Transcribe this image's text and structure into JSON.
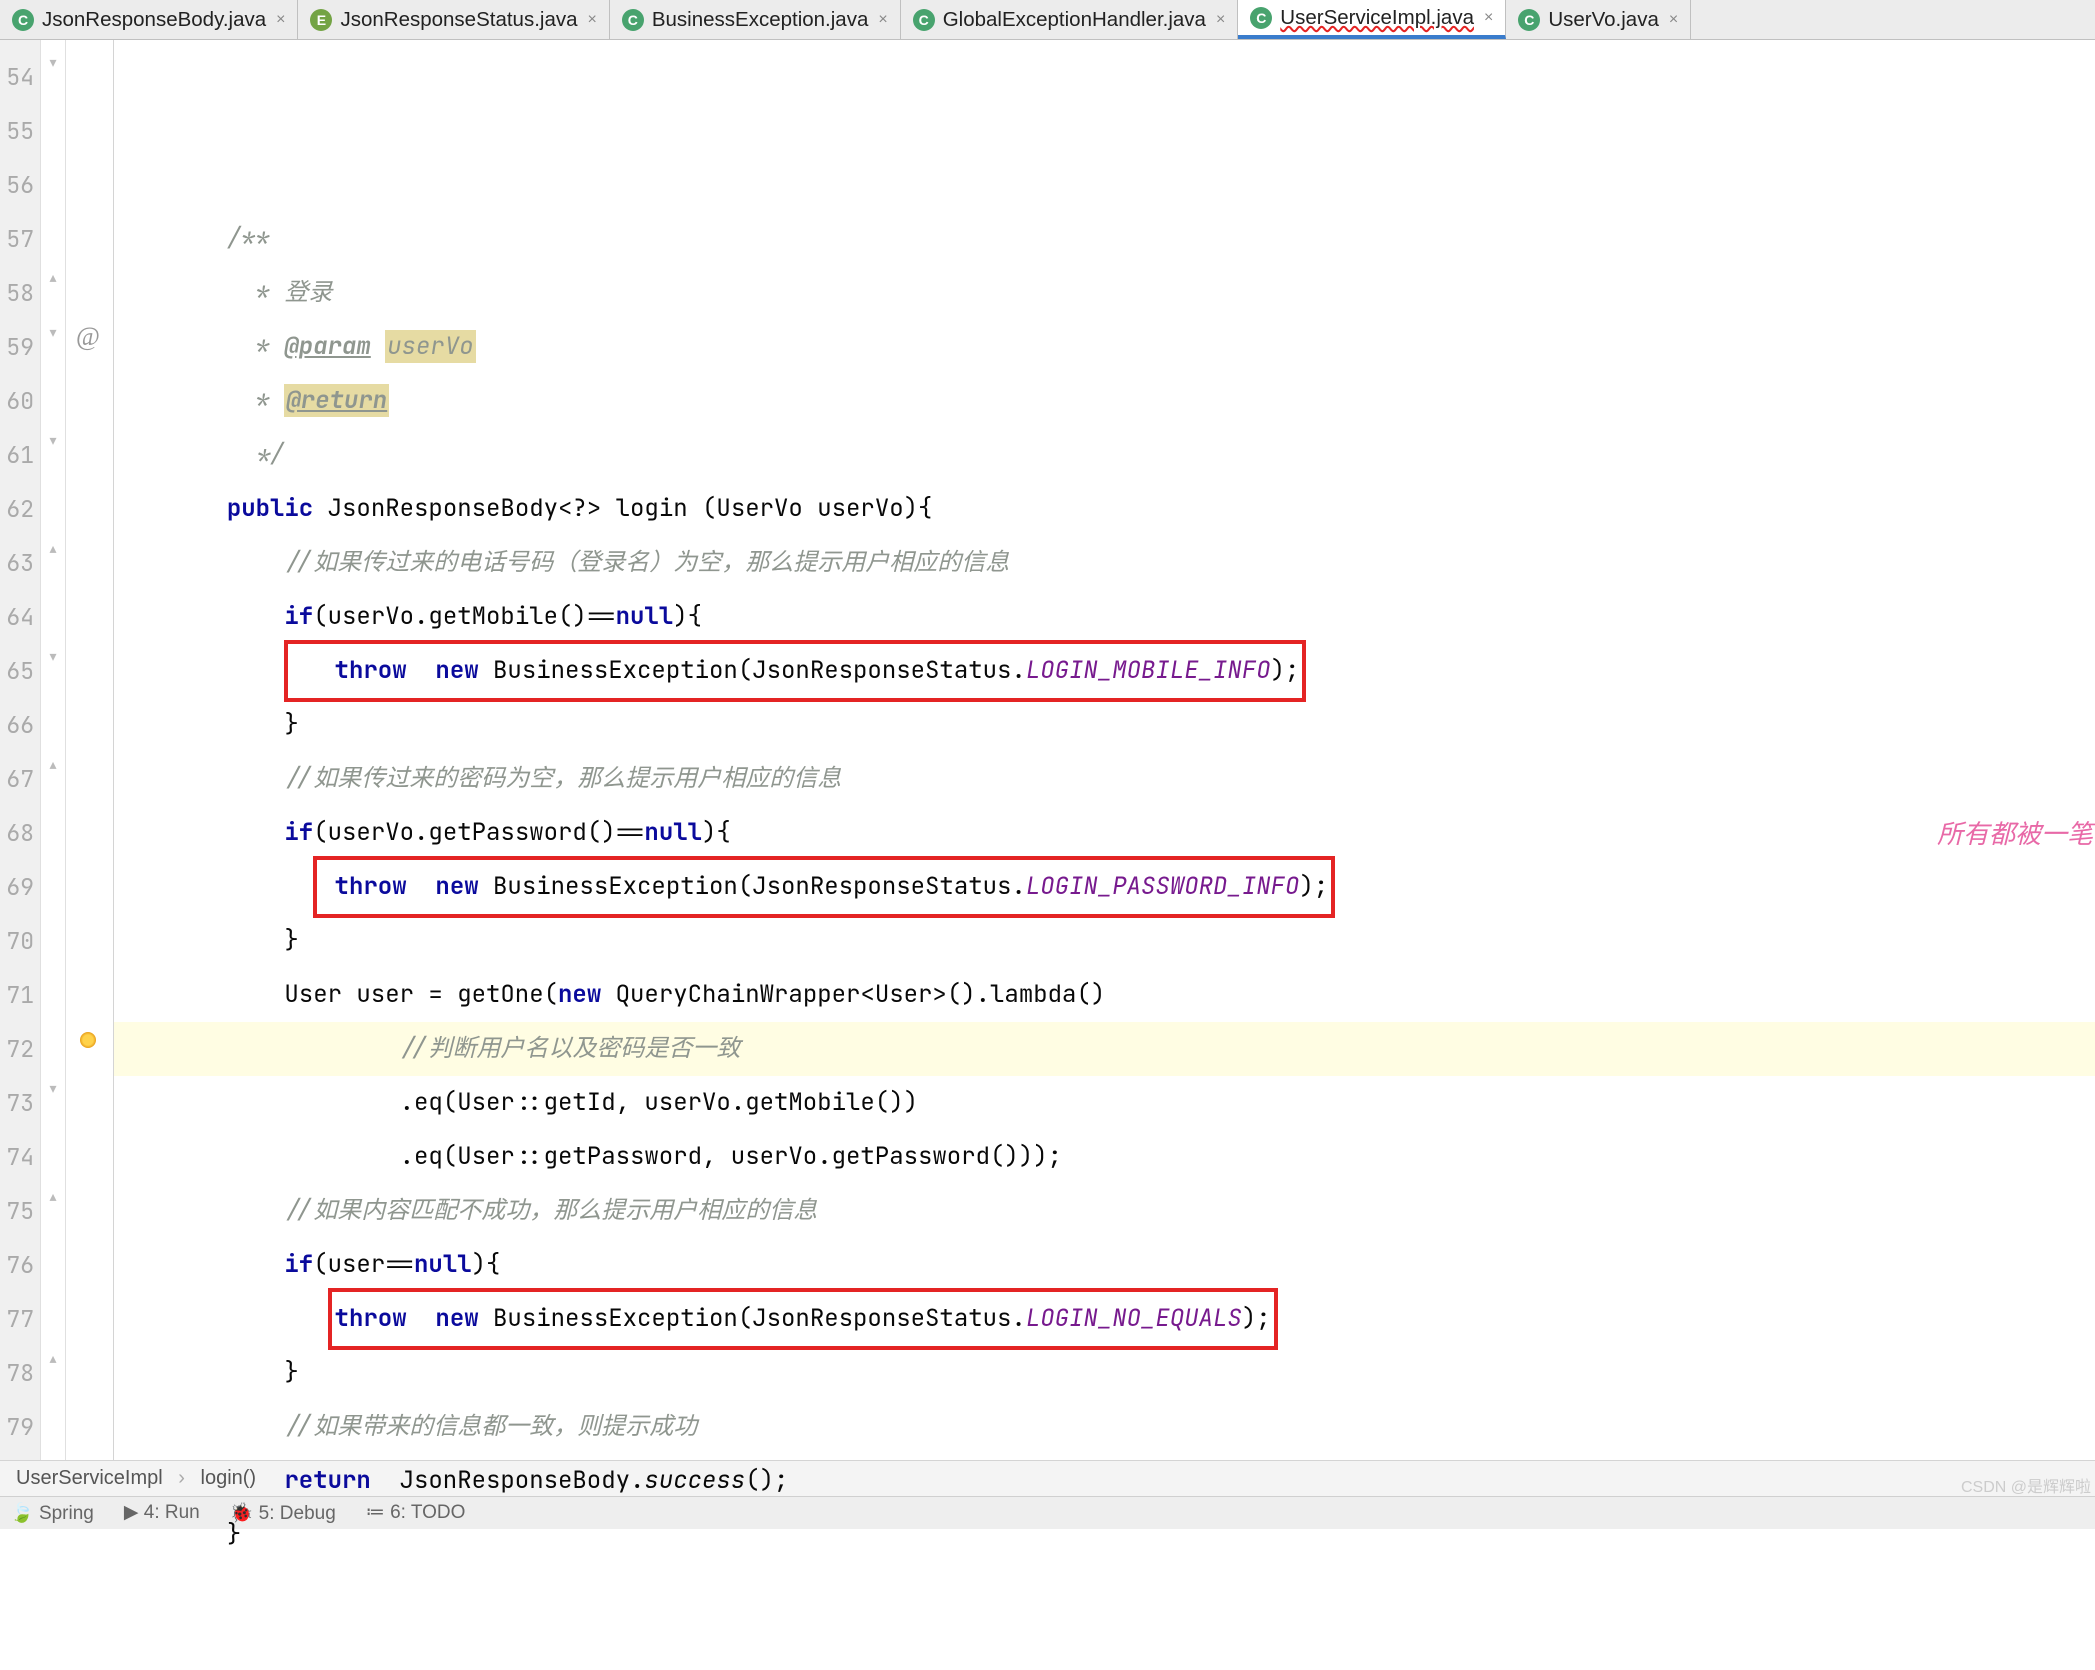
{
  "tabs": [
    {
      "icon": "C",
      "cls": "icon-c",
      "label": "JsonResponseBody.java",
      "active": false
    },
    {
      "icon": "E",
      "cls": "icon-e",
      "label": "JsonResponseStatus.java",
      "active": false
    },
    {
      "icon": "C",
      "cls": "icon-c",
      "label": "BusinessException.java",
      "active": false
    },
    {
      "icon": "C",
      "cls": "icon-c",
      "label": "GlobalExceptionHandler.java",
      "active": false
    },
    {
      "icon": "C",
      "cls": "icon-c",
      "label": "UserServiceImpl.java",
      "active": true,
      "squiggle": true
    },
    {
      "icon": "C",
      "cls": "icon-c",
      "label": "UserVo.java",
      "active": false
    }
  ],
  "line_start": 54,
  "line_end": 79,
  "code": {
    "c54": "/**",
    "c55_a": " * ",
    "c55_b": "登录",
    "c56_a": " * ",
    "c56_tag": "@param",
    "c56_b": " ",
    "c56_param": "userVo",
    "c57_a": " * ",
    "c57_tag": "@return",
    "c58": " */",
    "c59_kw1": "public",
    "c59_a": " JsonResponseBody<?> ",
    "c59_m": "login ",
    "c59_b": "(UserVo userVo){",
    "c60": "//如果传过来的电话号码（登录名）为空，那么提示用户相应的信息",
    "c61_kw": "if",
    "c61_a": "(userVo.getMobile()==",
    "c61_kw2": "null",
    "c61_b": "){",
    "c62_kw1": "throw",
    "c62_sp": "  ",
    "c62_kw2": "new",
    "c62_a": " BusinessException(JsonResponseStatus.",
    "c62_c": "LOGIN_MOBILE_INFO",
    "c62_b": ");",
    "c63": "}",
    "c64": "//如果传过来的密码为空，那么提示用户相应的信息",
    "c65_kw": "if",
    "c65_a": "(userVo.getPassword()==",
    "c65_kw2": "null",
    "c65_b": "){",
    "c66_kw1": "throw",
    "c66_sp": "  ",
    "c66_kw2": "new",
    "c66_a": " BusinessException(JsonResponseStatus.",
    "c66_c": "LOGIN_PASSWORD_INFO",
    "c66_b": ");",
    "c67": "}",
    "c68_a": "User user = getOne(",
    "c68_kw": "new",
    "c68_b": " QueryChainWrapper<User>().lambda()",
    "c69": "//判断用户名以及密码是否一致",
    "c70": ".eq(User::getId, userVo.getMobile())",
    "c71": ".eq(User::getPassword, userVo.getPassword()));",
    "c72": "//如果内容匹配不成功，那么提示用户相应的信息",
    "c73_kw": "if",
    "c73_a": "(user==",
    "c73_kw2": "null",
    "c73_b": "){",
    "c74_kw1": "throw",
    "c74_sp": "  ",
    "c74_kw2": "new",
    "c74_a": " BusinessException(JsonResponseStatus.",
    "c74_c": "LOGIN_NO_EQUALS",
    "c74_b": ");",
    "c75": "}",
    "c76": "//如果带来的信息都一致，则提示成功",
    "c77_kw": "return",
    "c77_a": "  JsonResponseBody.",
    "c77_m": "success",
    "c77_b": "();",
    "c78": "}",
    "pink_note": "所有都被一笔"
  },
  "breadcrumb": {
    "a": "UserServiceImpl",
    "b": "login()"
  },
  "tool": {
    "spring": "Spring",
    "run": "4: Run",
    "debug": "5: Debug",
    "todo": "6: TODO"
  },
  "watermark": "CSDN @是辉辉啦"
}
